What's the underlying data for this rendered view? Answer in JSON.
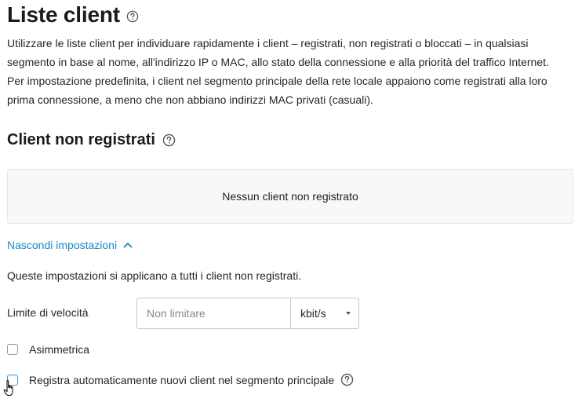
{
  "page": {
    "title": "Liste client",
    "title_help_icon": "help-circle-icon",
    "intro_lines": [
      "Utilizzare le liste client per individuare rapidamente i client – registrati, non registrati o bloccati – in qualsiasi",
      "segmento in base al nome, all'indirizzo IP o MAC, allo stato della connessione e alla priorità del traffico Internet.",
      "Per impostazione predefinita, i client nel segmento principale della rete locale appaiono come registrati alla loro",
      "prima connessione, a meno che non abbiano indirizzi MAC privati (casuali)."
    ]
  },
  "unregistered": {
    "title": "Client non registrati",
    "help_icon": "help-circle-icon",
    "empty_message": "Nessun client non registrato",
    "toggle_label": "Nascondi impostazioni",
    "toggle_icon": "chevron-up-icon",
    "settings_note": "Queste impostazioni si applicano a tutti i client non registrati.",
    "rate_limit": {
      "label": "Limite di velocità",
      "value": "",
      "placeholder": "Non limitare",
      "unit_selected": "kbit/s"
    },
    "asymmetric": {
      "label": "Asimmetrica",
      "checked": false
    },
    "auto_register": {
      "label": "Registra automaticamente nuovi client nel segmento principale",
      "checked": false,
      "help_icon": "help-circle-icon"
    }
  },
  "colors": {
    "link": "#1a87c9",
    "text": "#262626",
    "box_bg": "#f8f8f8"
  },
  "cursor_icon": "hand-pointer-icon"
}
